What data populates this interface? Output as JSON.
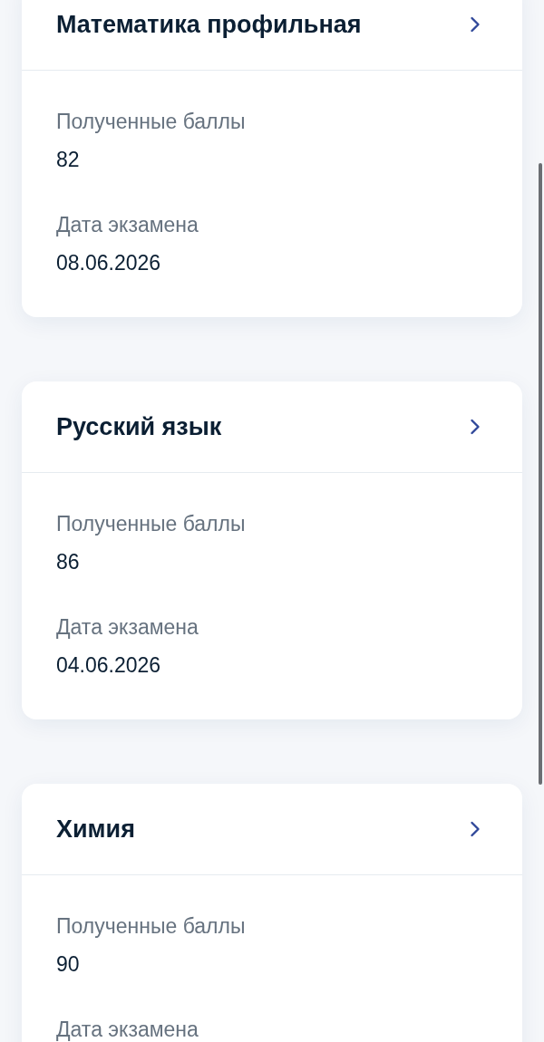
{
  "exams": [
    {
      "subject": "Математика профильная",
      "fields": [
        {
          "label": "Полученные баллы",
          "value": "82"
        },
        {
          "label": "Дата экзамена",
          "value": "08.06.2026"
        }
      ]
    },
    {
      "subject": "Русский язык",
      "fields": [
        {
          "label": "Полученные баллы",
          "value": "86"
        },
        {
          "label": "Дата экзамена",
          "value": "04.06.2026"
        }
      ]
    },
    {
      "subject": "Химия",
      "fields": [
        {
          "label": "Полученные баллы",
          "value": "90"
        },
        {
          "label": "Дата экзамена"
        }
      ]
    }
  ]
}
